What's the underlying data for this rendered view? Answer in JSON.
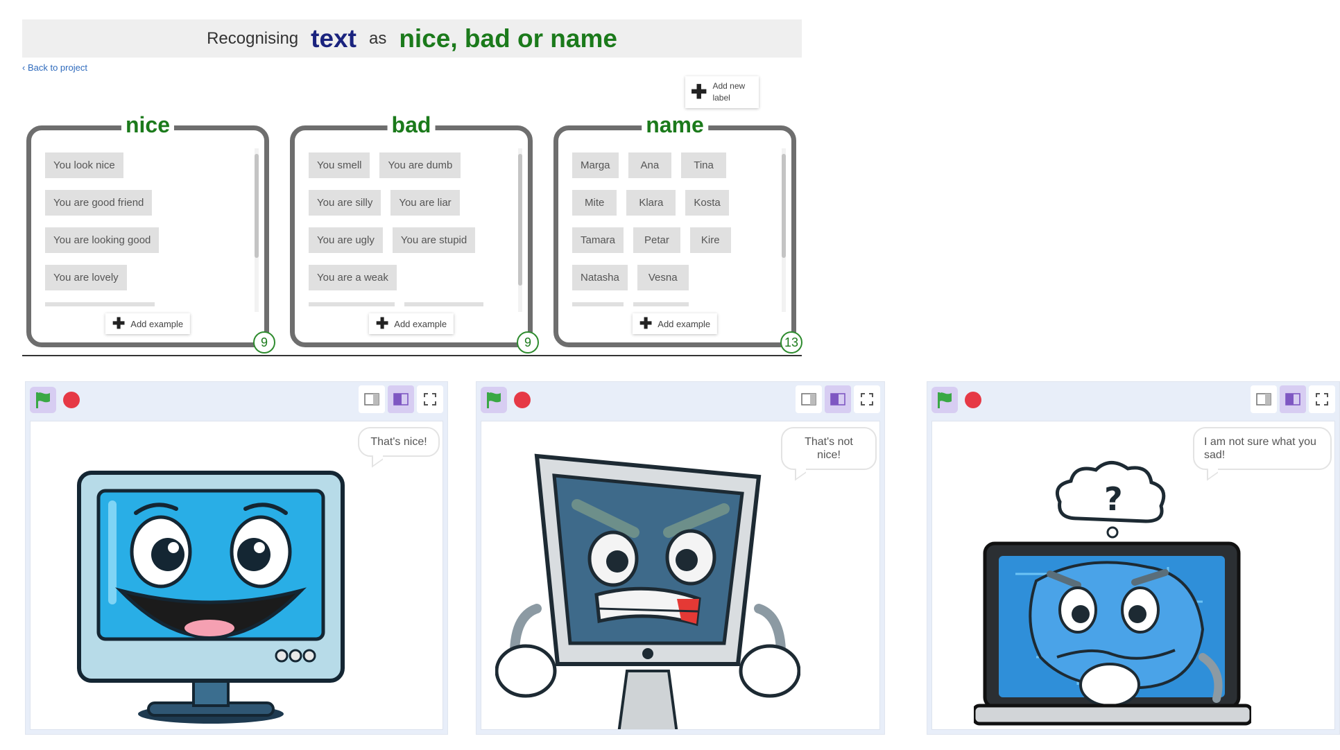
{
  "title_bar": {
    "prefix": "Recognising",
    "data_type": "text",
    "as_word": "as",
    "labels_text": "nice, bad or name"
  },
  "back_link": "‹ Back to project",
  "add_label": {
    "text": "Add new label"
  },
  "buckets": [
    {
      "name": "nice",
      "count": "9",
      "add_example": "Add example",
      "examples": [
        "You look nice",
        "You are good friend",
        "You are looking good",
        "You are lovely"
      ]
    },
    {
      "name": "bad",
      "count": "9",
      "add_example": "Add example",
      "examples": [
        "You smell",
        "You are dumb",
        "You are silly",
        "You are liar",
        "You are ugly",
        "You are stupid",
        "You are a weak"
      ]
    },
    {
      "name": "name",
      "count": "13",
      "add_example": "Add example",
      "examples": [
        "Marga",
        "Ana",
        "Tina",
        "Mite",
        "Klara",
        "Kosta",
        "Tamara",
        "Petar",
        "Kire",
        "Natasha",
        "Vesna"
      ]
    }
  ],
  "stages": [
    {
      "speech": "That's nice!",
      "character": "happy-monitor"
    },
    {
      "speech": "That's not nice!",
      "character": "angry-monitor"
    },
    {
      "speech": "I am not sure what you sad!",
      "character": "confused-laptop"
    }
  ],
  "colors": {
    "label_green": "#1b7a1b",
    "type_navy": "#1a237e",
    "flag_green": "#3aa845",
    "stop_red": "#e63946",
    "stage_bar": "#e8eef9",
    "screen_blue": "#29aee6"
  },
  "icons": {
    "flag": "green-flag-icon",
    "stop": "stop-icon",
    "small_stage": "small-stage-icon",
    "normal_stage": "normal-stage-icon",
    "fullscreen": "fullscreen-icon",
    "plus": "plus-icon"
  }
}
